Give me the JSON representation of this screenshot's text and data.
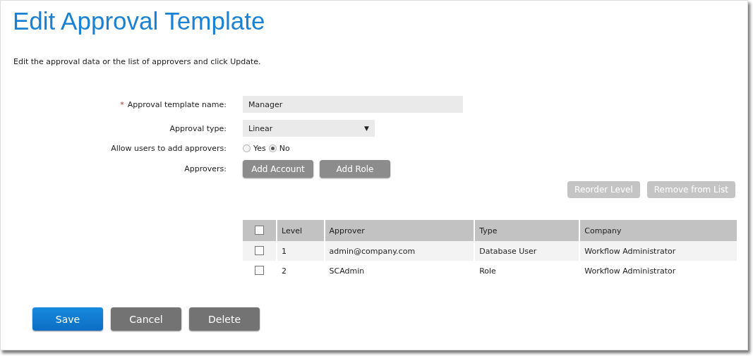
{
  "title": "Edit Approval Template",
  "instruction": "Edit the approval data or the list of approvers and click Update.",
  "form": [
    {
      "kind": "text",
      "label": "Approval template name:",
      "required": true,
      "required_mark": "*",
      "value": "Manager"
    },
    {
      "kind": "select",
      "label": "Approval type:",
      "required": false,
      "value": "Linear",
      "caret": "▼"
    },
    {
      "kind": "radio",
      "label": "Allow users to add approvers:",
      "required": false,
      "options": [
        {
          "label": "Yes",
          "selected": false
        },
        {
          "label": "No",
          "selected": true
        }
      ]
    },
    {
      "kind": "buttons",
      "label": "Approvers:",
      "required": false,
      "buttons": [
        "Add Account",
        "Add Role"
      ]
    }
  ],
  "list_actions": [
    {
      "label": "Reorder Level",
      "disabled": true
    },
    {
      "label": "Remove from List",
      "disabled": true
    }
  ],
  "table": {
    "select_all_checked": false,
    "columns": [
      "Level",
      "Approver",
      "Type",
      "Company"
    ],
    "rows": [
      {
        "checked": false,
        "cells": [
          "1",
          "admin@company.com",
          "Database User",
          "Workflow Administrator"
        ]
      },
      {
        "checked": false,
        "cells": [
          "2",
          "SCAdmin",
          "Role",
          "Workflow Administrator"
        ]
      }
    ]
  },
  "actions": [
    {
      "label": "Save",
      "kind": "primary"
    },
    {
      "label": "Cancel",
      "kind": "secondary"
    },
    {
      "label": "Delete",
      "kind": "secondary"
    }
  ]
}
